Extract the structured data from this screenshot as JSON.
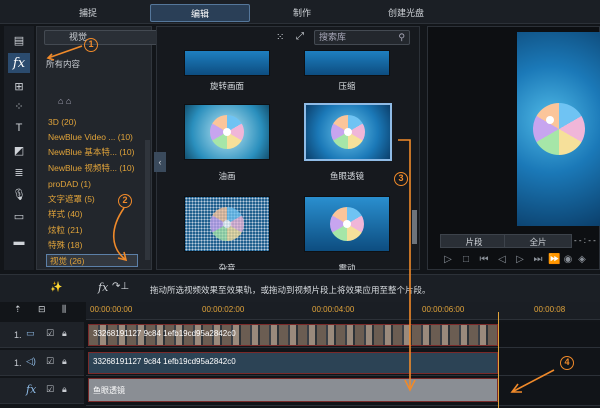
{
  "top_tabs": [
    "捕捉",
    "编辑",
    "制作",
    "创建光盘"
  ],
  "library": {
    "dropdown_value": "视觉",
    "search_placeholder": "搜索库",
    "all_content": "所有内容",
    "categories": [
      "3D  (20)",
      "NewBlue Video ...  (10)",
      "NewBlue 基本特...  (10)",
      "NewBlue 视频特...  (10)",
      "proDAD  (1)",
      "文字遮罩  (5)",
      "样式  (40)",
      "炫粒  (21)",
      "特殊  (18)",
      "视觉  (26)"
    ],
    "effects": [
      "旋转画面",
      "压缩",
      "油画",
      "鱼眼透镜",
      "杂音",
      "震动"
    ]
  },
  "preview": {
    "btn_segment": "片段",
    "btn_full": "全片",
    "timecode": "- - : - -"
  },
  "status_text": "拖动所选视频效果至效果轨，或拖动到视频片段上将效果应用至整个片段。",
  "timeline": {
    "ticks": [
      "00:00:00:00",
      "00:00:02:00",
      "00:00:04:00",
      "00:00:06:00",
      "00:00:08"
    ],
    "track_video_label": "1.",
    "track_audio_label": "1.",
    "track_fx_label": "fx",
    "video_clip": "33268191127 9c84 1efb19cd95a2842c0",
    "audio_clip": "33268191127 9c84 1efb19cd95a2842c0",
    "fx_clip": "鱼眼透镜"
  },
  "annotations": [
    "1",
    "2",
    "3",
    "4"
  ],
  "colors": {
    "accent_orange": "#f08a2a",
    "category_text": "#e0a33a",
    "selected_border": "#8fbbe6"
  }
}
